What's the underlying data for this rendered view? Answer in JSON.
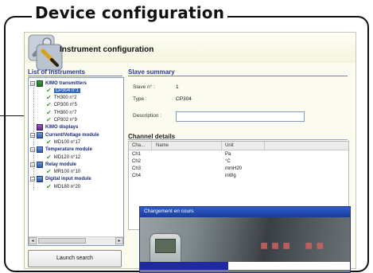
{
  "headline": "Device configuration",
  "window": {
    "title": "Instrument configuration"
  },
  "list": {
    "title": "List of instruments",
    "items": [
      {
        "label": "KIMO transmitters",
        "kind": "group"
      },
      {
        "label": "CP304 n°1",
        "kind": "device",
        "selected": true
      },
      {
        "label": "TH300 n°2",
        "kind": "device"
      },
      {
        "label": "CP300 n°5",
        "kind": "device"
      },
      {
        "label": "TH300 n°7",
        "kind": "device"
      },
      {
        "label": "CP302 n°9",
        "kind": "device"
      },
      {
        "label": "KIMO displays",
        "kind": "group"
      },
      {
        "label": "Current/Voltage module",
        "kind": "group"
      },
      {
        "label": "MD100 n°17",
        "kind": "device"
      },
      {
        "label": "Temperature module",
        "kind": "group"
      },
      {
        "label": "MD120 n°12",
        "kind": "device"
      },
      {
        "label": "Relay module",
        "kind": "group"
      },
      {
        "label": "MR100 n°10",
        "kind": "device"
      },
      {
        "label": "Digital input module",
        "kind": "group"
      },
      {
        "label": "MD180 n°20",
        "kind": "device"
      }
    ]
  },
  "launch_button": "Launch search",
  "slave_summary": {
    "title": "Slave summary",
    "slave_label": "Slave n° :",
    "slave_value": "1",
    "type_label": "Type :",
    "type_value": "CP304",
    "description_label": "Description :",
    "description_value": ""
  },
  "channel_details": {
    "title": "Channel details",
    "columns": [
      "Cha...",
      "Name",
      "Unit"
    ],
    "rows": [
      [
        "Ch1",
        "",
        "Pa"
      ],
      [
        "Ch2",
        "",
        "°C"
      ],
      [
        "Ch3",
        "",
        "mmH20"
      ],
      [
        "Ch4",
        "",
        "inWg"
      ]
    ]
  },
  "loading": {
    "title": "Chargement en cours",
    "progress": 0.42
  },
  "colors": {
    "accent": "#1f2a9e",
    "title_blue": "#2a3a9a",
    "selection": "#316ac5"
  }
}
